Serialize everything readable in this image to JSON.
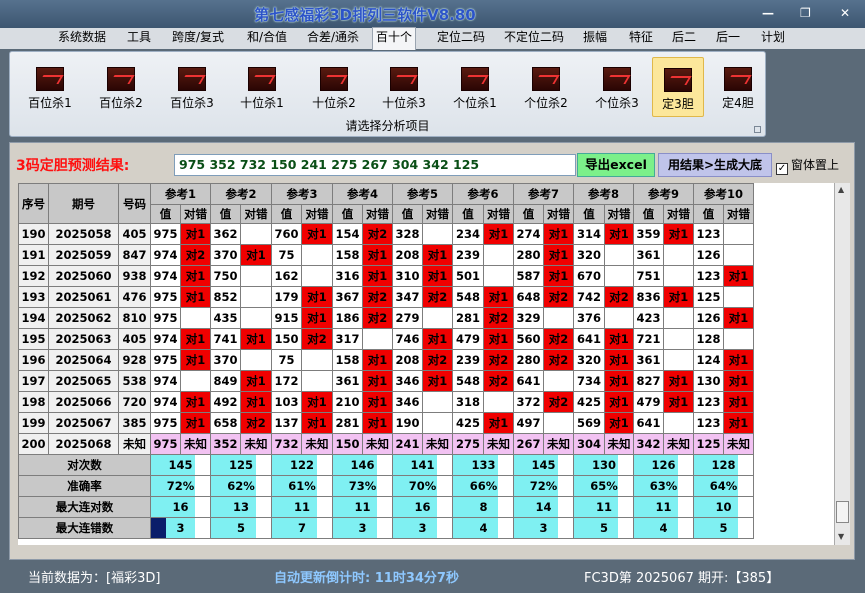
{
  "window": {
    "title": "第七感福彩3D排列三软件V8.80",
    "minimize": "—",
    "restore": "❐",
    "close": "✕"
  },
  "menu": [
    "系统数据",
    "工具",
    "跨度/复式",
    "和/合值",
    "合差/通杀",
    "百十个",
    "定位二码",
    "不定位二码",
    "振幅",
    "特征",
    "后二",
    "后一",
    "计划"
  ],
  "menu_active_index": 5,
  "ribbon": {
    "buttons": [
      "百位杀1",
      "百位杀2",
      "百位杀3",
      "十位杀1",
      "十位杀2",
      "十位杀3",
      "个位杀1",
      "个位杀2",
      "个位杀3",
      "定3胆",
      "定4胆"
    ],
    "selected_index": 9,
    "caption": "请选择分析项目",
    "icon": "chart-icon"
  },
  "prediction": {
    "label": "3码定胆预测结果:",
    "value": "975 352 732 150 241 275 267 304 342 125",
    "export_button": "导出excel",
    "generate_button": "用结果>生成大底",
    "topmost_label": "窗体置上",
    "topmost_checked": "✓"
  },
  "table": {
    "fixed_headers": [
      "序号",
      "期号",
      "号码"
    ],
    "ref_headers": [
      "参考1",
      "参考2",
      "参考3",
      "参考4",
      "参考5",
      "参考6",
      "参考7",
      "参考8",
      "参考9",
      "参考10"
    ],
    "sub_headers": [
      "值",
      "对错"
    ],
    "rows": [
      {
        "seq": "190",
        "period": "2025058",
        "num": "405",
        "cells": [
          [
            "975",
            "r",
            "对1"
          ],
          [
            "362",
            "r",
            ""
          ],
          [
            "760",
            "b",
            "对1"
          ],
          [
            "154",
            "b",
            "对2"
          ],
          [
            "328",
            "r",
            ""
          ],
          [
            "234",
            "b",
            "对1"
          ],
          [
            "274",
            "b",
            "对1"
          ],
          [
            "314",
            "b",
            "对1"
          ],
          [
            "359",
            "b",
            "对1"
          ],
          [
            "123",
            "r",
            ""
          ]
        ]
      },
      {
        "seq": "191",
        "period": "2025059",
        "num": "847",
        "cells": [
          [
            "974",
            "b",
            "对2"
          ],
          [
            "370",
            "b",
            "对1"
          ],
          [
            "75",
            "r",
            ""
          ],
          [
            "158",
            "b",
            "对1"
          ],
          [
            "208",
            "b",
            "对1"
          ],
          [
            "239",
            "r",
            ""
          ],
          [
            "280",
            "b",
            "对1"
          ],
          [
            "320",
            "r",
            ""
          ],
          [
            "361",
            "r",
            ""
          ],
          [
            "126",
            "r",
            ""
          ]
        ]
      },
      {
        "seq": "192",
        "period": "2025060",
        "num": "938",
        "cells": [
          [
            "974",
            "b",
            "对1"
          ],
          [
            "750",
            "r",
            ""
          ],
          [
            "162",
            "r",
            ""
          ],
          [
            "316",
            "b",
            "对1"
          ],
          [
            "310",
            "b",
            "对1"
          ],
          [
            "501",
            "r",
            ""
          ],
          [
            "587",
            "b",
            "对1"
          ],
          [
            "670",
            "r",
            ""
          ],
          [
            "751",
            "r",
            ""
          ],
          [
            "123",
            "b",
            "对1"
          ]
        ]
      },
      {
        "seq": "193",
        "period": "2025061",
        "num": "476",
        "cells": [
          [
            "975",
            "b",
            "对1"
          ],
          [
            "852",
            "r",
            ""
          ],
          [
            "179",
            "b",
            "对1"
          ],
          [
            "367",
            "b",
            "对2"
          ],
          [
            "347",
            "b",
            "对2"
          ],
          [
            "548",
            "b",
            "对1"
          ],
          [
            "648",
            "b",
            "对2"
          ],
          [
            "742",
            "b",
            "对2"
          ],
          [
            "836",
            "b",
            "对1"
          ],
          [
            "125",
            "r",
            ""
          ]
        ]
      },
      {
        "seq": "194",
        "period": "2025062",
        "num": "810",
        "cells": [
          [
            "975",
            "r",
            ""
          ],
          [
            "435",
            "r",
            ""
          ],
          [
            "915",
            "b",
            "对1"
          ],
          [
            "186",
            "b",
            "对2"
          ],
          [
            "279",
            "r",
            ""
          ],
          [
            "281",
            "b",
            "对2"
          ],
          [
            "329",
            "r",
            ""
          ],
          [
            "376",
            "r",
            ""
          ],
          [
            "423",
            "r",
            ""
          ],
          [
            "126",
            "b",
            "对1"
          ]
        ]
      },
      {
        "seq": "195",
        "period": "2025063",
        "num": "405",
        "cells": [
          [
            "974",
            "b",
            "对1"
          ],
          [
            "741",
            "b",
            "对1"
          ],
          [
            "150",
            "b",
            "对2"
          ],
          [
            "317",
            "r",
            ""
          ],
          [
            "746",
            "b",
            "对1"
          ],
          [
            "479",
            "b",
            "对1"
          ],
          [
            "560",
            "b",
            "对2"
          ],
          [
            "641",
            "b",
            "对1"
          ],
          [
            "721",
            "r",
            ""
          ],
          [
            "128",
            "r",
            ""
          ]
        ]
      },
      {
        "seq": "196",
        "period": "2025064",
        "num": "928",
        "cells": [
          [
            "975",
            "b",
            "对1"
          ],
          [
            "370",
            "r",
            ""
          ],
          [
            "75",
            "r",
            ""
          ],
          [
            "158",
            "b",
            "对1"
          ],
          [
            "208",
            "b",
            "对2"
          ],
          [
            "239",
            "b",
            "对2"
          ],
          [
            "280",
            "b",
            "对2"
          ],
          [
            "320",
            "b",
            "对1"
          ],
          [
            "361",
            "r",
            ""
          ],
          [
            "124",
            "b",
            "对1"
          ]
        ]
      },
      {
        "seq": "197",
        "period": "2025065",
        "num": "538",
        "cells": [
          [
            "974",
            "r",
            ""
          ],
          [
            "849",
            "b",
            "对1"
          ],
          [
            "172",
            "r",
            ""
          ],
          [
            "361",
            "b",
            "对1"
          ],
          [
            "346",
            "b",
            "对1"
          ],
          [
            "548",
            "b",
            "对2"
          ],
          [
            "641",
            "r",
            ""
          ],
          [
            "734",
            "b",
            "对1"
          ],
          [
            "827",
            "b",
            "对1"
          ],
          [
            "130",
            "b",
            "对1"
          ]
        ]
      },
      {
        "seq": "198",
        "period": "2025066",
        "num": "720",
        "cells": [
          [
            "974",
            "b",
            "对1"
          ],
          [
            "492",
            "b",
            "对1"
          ],
          [
            "103",
            "b",
            "对1"
          ],
          [
            "210",
            "b",
            "对1"
          ],
          [
            "346",
            "r",
            ""
          ],
          [
            "318",
            "r",
            ""
          ],
          [
            "372",
            "b",
            "对2"
          ],
          [
            "425",
            "b",
            "对1"
          ],
          [
            "479",
            "b",
            "对1"
          ],
          [
            "123",
            "b",
            "对1"
          ]
        ]
      },
      {
        "seq": "199",
        "period": "2025067",
        "num": "385",
        "cells": [
          [
            "975",
            "b",
            "对1"
          ],
          [
            "658",
            "b",
            "对2"
          ],
          [
            "137",
            "b",
            "对1"
          ],
          [
            "281",
            "b",
            "对1"
          ],
          [
            "190",
            "r",
            ""
          ],
          [
            "425",
            "b",
            "对1"
          ],
          [
            "497",
            "r",
            ""
          ],
          [
            "569",
            "b",
            "对1"
          ],
          [
            "641",
            "r",
            ""
          ],
          [
            "123",
            "b",
            "对1"
          ]
        ]
      }
    ],
    "last_row": {
      "seq": "200",
      "period": "2025068",
      "num": "未知",
      "values": [
        "975",
        "352",
        "732",
        "150",
        "241",
        "275",
        "267",
        "304",
        "342",
        "125"
      ],
      "mark": "未知"
    },
    "stat_labels": [
      "对次数",
      "准确率",
      "最大连对数",
      "最大连错数"
    ],
    "stats": {
      "hits": [
        "145",
        "125",
        "122",
        "146",
        "141",
        "133",
        "145",
        "130",
        "126",
        "128"
      ],
      "rate": [
        "72%",
        "62%",
        "61%",
        "73%",
        "70%",
        "66%",
        "72%",
        "65%",
        "63%",
        "64%"
      ],
      "maxwin": [
        "16",
        "13",
        "11",
        "11",
        "16",
        "8",
        "14",
        "11",
        "11",
        "10"
      ],
      "maxlose": [
        "3",
        "5",
        "7",
        "3",
        "3",
        "4",
        "3",
        "5",
        "4",
        "5"
      ]
    }
  },
  "status": {
    "current_data": "当前数据为：[福彩3D]",
    "countdown": "自动更新倒计时:  11时34分7秒",
    "issue": "FC3D第 2025067 期开:【385】"
  },
  "colors": {
    "hit": "#f00000",
    "miss_value": "#ff1a1a",
    "stats_bg": "#7ff0f2",
    "next_row_bg": "#f2c2f2",
    "accent_blue": "#0000c8"
  }
}
